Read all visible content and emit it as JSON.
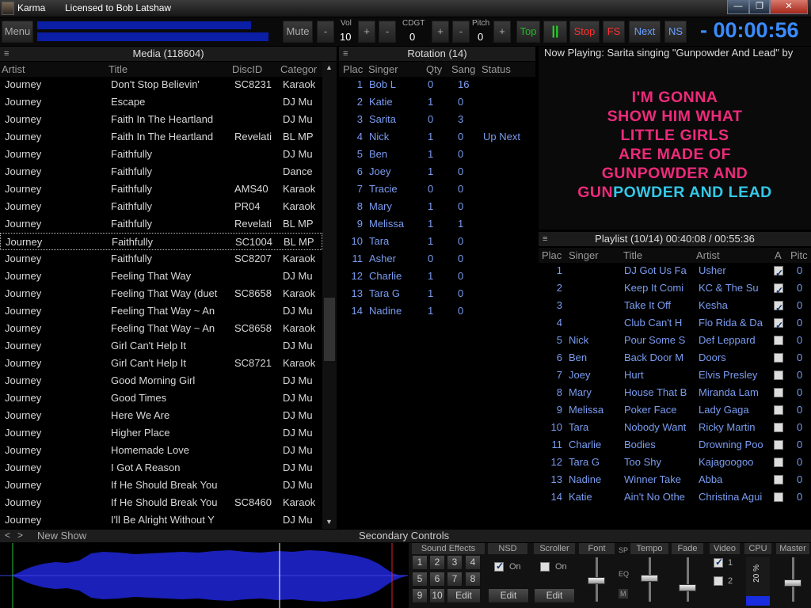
{
  "window": {
    "app_name": "Karma",
    "license": "Licensed to Bob Latshaw",
    "minimize": "—",
    "maximize": "❐",
    "close": "✕"
  },
  "toolbar": {
    "menu": "Menu",
    "mute": "Mute",
    "vol_label": "Vol",
    "vol_value": "10",
    "cdgt_label": "CDGT",
    "cdgt_value": "0",
    "pitch_label": "Pitch",
    "pitch_value": "0",
    "minus": "-",
    "plus": "+",
    "top": "Top",
    "pause": "||",
    "stop": "Stop",
    "fs": "FS",
    "next": "Next",
    "ns": "NS",
    "timer": "- 00:00:56",
    "colors": {
      "top": "#22bb22",
      "pause": "#22dd22",
      "stop": "#ff3030",
      "fs": "#ff3030",
      "next": "#6aa0ff",
      "ns": "#6aa0ff",
      "timer": "#3a8cff"
    }
  },
  "media": {
    "title": "Media (118604)",
    "columns": [
      "Artist",
      "Title",
      "DiscID",
      "Categor"
    ],
    "rows": [
      [
        "Journey",
        "Don't Stop Believin'",
        "SC8231",
        "Karaok"
      ],
      [
        "Journey",
        "Escape",
        "",
        "DJ Mu"
      ],
      [
        "Journey",
        "Faith In The Heartland",
        "",
        "DJ Mu"
      ],
      [
        "Journey",
        "Faith In The Heartland",
        "Revelati",
        "BL MP"
      ],
      [
        "Journey",
        "Faithfully",
        "",
        "DJ Mu"
      ],
      [
        "Journey",
        "Faithfully",
        "",
        "Dance"
      ],
      [
        "Journey",
        "Faithfully",
        "AMS40",
        "Karaok"
      ],
      [
        "Journey",
        "Faithfully",
        "PR04",
        "Karaok"
      ],
      [
        "Journey",
        "Faithfully",
        "Revelati",
        "BL MP"
      ],
      [
        "Journey",
        "Faithfully",
        "SC1004",
        "BL MP"
      ],
      [
        "Journey",
        "Faithfully",
        "SC8207",
        "Karaok"
      ],
      [
        "Journey",
        "Feeling That Way",
        "",
        "DJ Mu"
      ],
      [
        "Journey",
        "Feeling That Way (duet",
        "SC8658",
        "Karaok"
      ],
      [
        "Journey",
        "Feeling That Way ~ An",
        "",
        "DJ Mu"
      ],
      [
        "Journey",
        "Feeling That Way ~ An",
        "SC8658",
        "Karaok"
      ],
      [
        "Journey",
        "Girl Can't Help It",
        "",
        "DJ Mu"
      ],
      [
        "Journey",
        "Girl Can't Help It",
        "SC8721",
        "Karaok"
      ],
      [
        "Journey",
        "Good Morning Girl",
        "",
        "DJ Mu"
      ],
      [
        "Journey",
        "Good Times",
        "",
        "DJ Mu"
      ],
      [
        "Journey",
        "Here We Are",
        "",
        "DJ Mu"
      ],
      [
        "Journey",
        "Higher Place",
        "",
        "DJ Mu"
      ],
      [
        "Journey",
        "Homemade Love",
        "",
        "DJ Mu"
      ],
      [
        "Journey",
        "I Got A Reason",
        "",
        "DJ Mu"
      ],
      [
        "Journey",
        "If He Should Break You",
        "",
        "DJ Mu"
      ],
      [
        "Journey",
        "If He Should Break You",
        "SC8460",
        "Karaok"
      ],
      [
        "Journey",
        "I'll Be Alright Without Y",
        "",
        "DJ Mu"
      ]
    ]
  },
  "rotation": {
    "title": "Rotation (14)",
    "columns": [
      "Plac",
      "Singer",
      "Qty",
      "Sang",
      "Status"
    ],
    "rows": [
      [
        "1",
        "Bob L",
        "0",
        "16",
        ""
      ],
      [
        "2",
        "Katie",
        "1",
        "0",
        ""
      ],
      [
        "3",
        "Sarita",
        "0",
        "3",
        ""
      ],
      [
        "4",
        "Nick",
        "1",
        "0",
        "Up Next"
      ],
      [
        "5",
        "Ben",
        "1",
        "0",
        ""
      ],
      [
        "6",
        "Joey",
        "1",
        "0",
        ""
      ],
      [
        "7",
        "Tracie",
        "0",
        "0",
        ""
      ],
      [
        "8",
        "Mary",
        "1",
        "0",
        ""
      ],
      [
        "9",
        "Melissa",
        "1",
        "1",
        ""
      ],
      [
        "10",
        "Tara",
        "1",
        "0",
        ""
      ],
      [
        "11",
        "Asher",
        "0",
        "0",
        ""
      ],
      [
        "12",
        "Charlie",
        "1",
        "0",
        ""
      ],
      [
        "13",
        "Tara G",
        "1",
        "0",
        ""
      ],
      [
        "14",
        "Nadine",
        "1",
        "0",
        ""
      ]
    ]
  },
  "now_playing": {
    "text": "Now Playing:  Sarita singing \"Gunpowder And Lead\" by",
    "lyrics": [
      "I'M GONNA",
      "SHOW HIM WHAT",
      "LITTLE GIRLS",
      "ARE MADE OF",
      "GUNPOWDER AND"
    ],
    "last_sung": "GUN",
    "last_unsung": "POWDER AND LEAD",
    "colors": {
      "sung": "#ee2a7b",
      "unsung": "#33c8e8"
    }
  },
  "playlist": {
    "title": "Playlist (10/14)  00:40:08 / 00:55:36",
    "columns": [
      "Plac",
      "Singer",
      "Title",
      "Artist",
      "A",
      "Pitc"
    ],
    "rows": [
      [
        "1",
        "",
        "DJ Got Us Fa",
        "Usher",
        true,
        "0"
      ],
      [
        "2",
        "",
        "Keep It Comi",
        "KC & The Su",
        true,
        "0"
      ],
      [
        "3",
        "",
        "Take It Off",
        "Kesha",
        true,
        "0"
      ],
      [
        "4",
        "",
        "Club Can't H",
        "Flo Rida & Da",
        true,
        "0"
      ],
      [
        "5",
        "Nick",
        "Pour Some S",
        "Def Leppard",
        false,
        "0"
      ],
      [
        "6",
        "Ben",
        "Back Door M",
        "Doors",
        false,
        "0"
      ],
      [
        "7",
        "Joey",
        "Hurt",
        "Elvis Presley",
        false,
        "0"
      ],
      [
        "8",
        "Mary",
        "House That B",
        "Miranda Lam",
        false,
        "0"
      ],
      [
        "9",
        "Melissa",
        "Poker Face",
        "Lady Gaga",
        false,
        "0"
      ],
      [
        "10",
        "Tara",
        "Nobody Want",
        "Ricky Martin",
        false,
        "0"
      ],
      [
        "11",
        "Charlie",
        "Bodies",
        "Drowning Poo",
        false,
        "0"
      ],
      [
        "12",
        "Tara G",
        "Too Shy",
        "Kajagoogoo",
        false,
        "0"
      ],
      [
        "13",
        "Nadine",
        "Winner Take",
        "Abba",
        false,
        "0"
      ],
      [
        "14",
        "Katie",
        "Ain't No Othe",
        "Christina Agui",
        false,
        "0"
      ]
    ]
  },
  "show": {
    "prev": "<",
    "next": ">",
    "name": "New Show"
  },
  "secondary": {
    "title": "Secondary Controls",
    "sound_effects": "Sound Effects",
    "sfx_buttons": [
      "1",
      "2",
      "3",
      "4",
      "5",
      "6",
      "7",
      "8",
      "9",
      "10"
    ],
    "sfx_edit": "Edit",
    "nsd": "NSD",
    "nsd_on": "On",
    "nsd_checked": true,
    "nsd_edit": "Edit",
    "scroller": "Scroller",
    "scroller_on": "On",
    "scroller_checked": false,
    "scroller_edit": "Edit",
    "font": "Font",
    "sp": "SP",
    "eq": "EQ",
    "m": "M",
    "tempo": "Tempo",
    "fade": "Fade",
    "video": "Video",
    "video_1": "1",
    "video_2": "2",
    "video_1_checked": true,
    "video_2_checked": false,
    "cpu": "CPU",
    "cpu_value": "20 %",
    "cpu_level": 0.2,
    "master": "Master"
  }
}
